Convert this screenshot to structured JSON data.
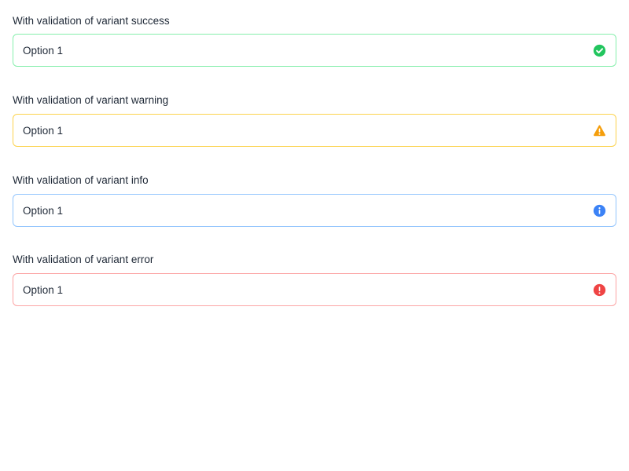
{
  "fields": [
    {
      "label": "With validation of variant success",
      "value": "Option 1",
      "variant": "success",
      "icon": "check-circle-icon",
      "color": "#22c55e"
    },
    {
      "label": "With validation of variant warning",
      "value": "Option 1",
      "variant": "warning",
      "icon": "warning-triangle-icon",
      "color": "#f59e0b"
    },
    {
      "label": "With validation of variant info",
      "value": "Option 1",
      "variant": "info",
      "icon": "info-circle-icon",
      "color": "#3b82f6"
    },
    {
      "label": "With validation of variant error",
      "value": "Option 1",
      "variant": "error",
      "icon": "error-circle-icon",
      "color": "#ef4444"
    }
  ]
}
